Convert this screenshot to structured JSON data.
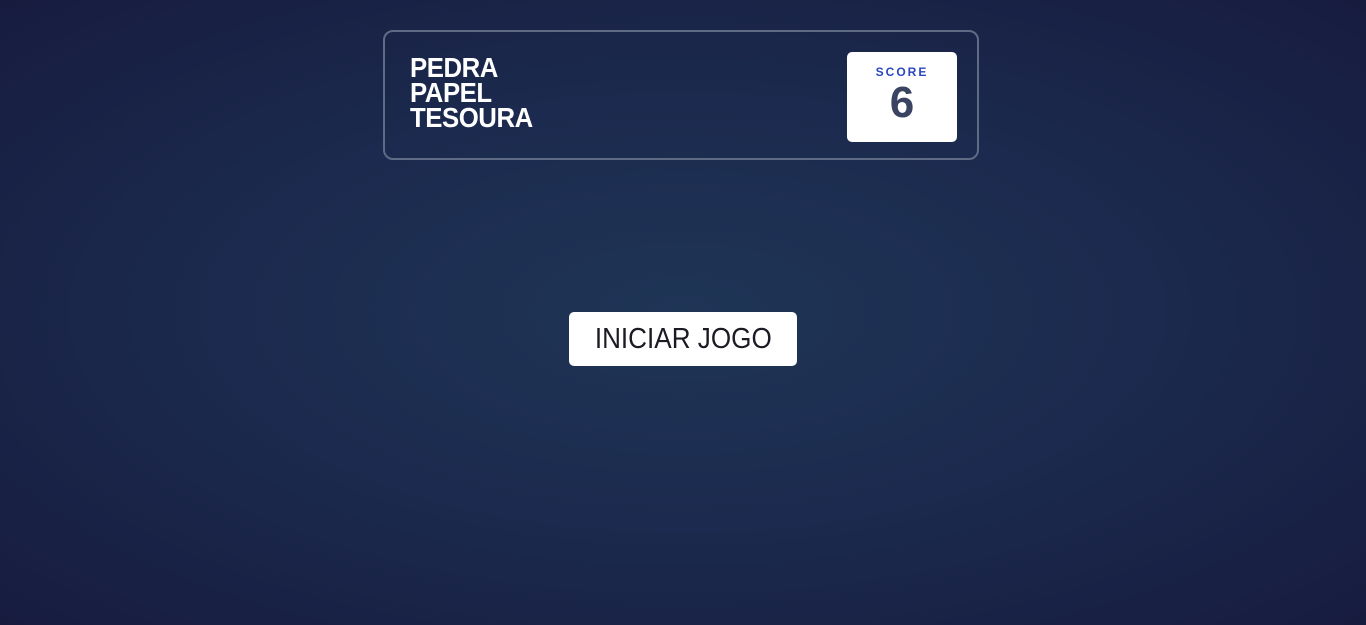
{
  "header": {
    "title_lines": [
      "PEDRA",
      "PAPEL",
      "TESOURA"
    ],
    "score_label": "SCORE",
    "score_value": "6"
  },
  "main": {
    "start_button_label": "INICIAR JOGO"
  },
  "colors": {
    "background_center": "#1f3556",
    "background_edge": "#161a3d",
    "header_border": "#5f6b85",
    "score_label": "#2a46c0",
    "score_value": "#3b4363"
  }
}
